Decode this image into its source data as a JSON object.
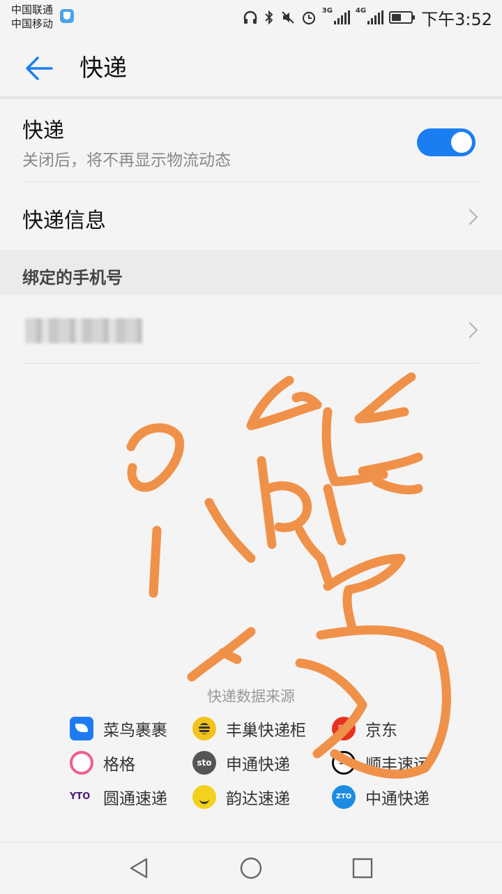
{
  "status_bar": {
    "carrier_1": "中国联通",
    "carrier_2": "中国移动",
    "network_1": "3G",
    "network_2": "4G",
    "time": "下午3:52",
    "icons": [
      "shield-icon",
      "headphones-icon",
      "bluetooth-icon",
      "mute-icon",
      "alarm-icon",
      "signal-icon",
      "battery-icon"
    ]
  },
  "header": {
    "title": "快递",
    "back_icon": "arrow-left-icon"
  },
  "toggle_row": {
    "title": "快递",
    "subtitle": "关闭后，将不再显示物流动态",
    "enabled": true,
    "accent": "#1a7ef2"
  },
  "info_row": {
    "label": "快递信息"
  },
  "bound_phone": {
    "section_title": "绑定的手机号",
    "value_blurred": true
  },
  "sources": {
    "title": "快递数据来源",
    "items": [
      {
        "name": "菜鸟裹裹",
        "icon": "cainiao-icon"
      },
      {
        "name": "丰巢快递柜",
        "icon": "fengchao-icon"
      },
      {
        "name": "京东",
        "icon": "jd-icon",
        "icon_text": "京东"
      },
      {
        "name": "格格",
        "icon": "gege-icon"
      },
      {
        "name": "申通快递",
        "icon": "sto-icon",
        "icon_text": "sto"
      },
      {
        "name": "顺丰速运",
        "icon": "sf-icon",
        "icon_text": "SF"
      },
      {
        "name": "圆通速递",
        "icon": "yto-icon",
        "icon_text": "YTO"
      },
      {
        "name": "韵达速递",
        "icon": "yunda-icon"
      },
      {
        "name": "中通快递",
        "icon": "zto-icon",
        "icon_text": "ZTO"
      }
    ]
  },
  "annotation": {
    "color": "#f0914a"
  },
  "nav_bar": {
    "icons": [
      "nav-back-icon",
      "nav-home-icon",
      "nav-recents-icon"
    ]
  }
}
